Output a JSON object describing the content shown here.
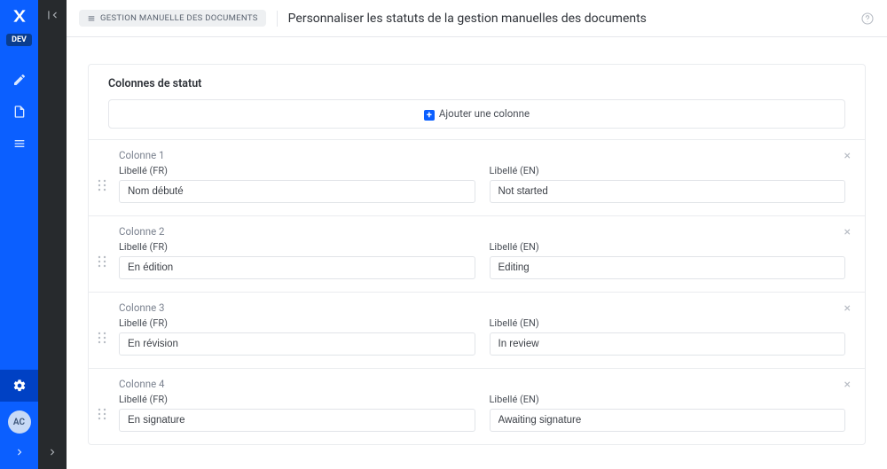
{
  "dev_label": "DEV",
  "avatar_initials": "AC",
  "breadcrumb": "GESTION MANUELLE DES DOCUMENTS",
  "page_title": "Personnaliser les statuts de la gestion manuelles des documents",
  "card_title": "Colonnes de statut",
  "add_column_label": "Ajouter une colonne",
  "label_fr": "Libellé (FR)",
  "label_en": "Libellé (EN)",
  "columns": [
    {
      "title": "Colonne 1",
      "fr": "Nom débuté",
      "en": "Not started"
    },
    {
      "title": "Colonne 2",
      "fr": "En édition",
      "en": "Editing"
    },
    {
      "title": "Colonne 3",
      "fr": "En révision",
      "en": "In review"
    },
    {
      "title": "Colonne 4",
      "fr": "En signature",
      "en": "Awaiting signature"
    }
  ]
}
